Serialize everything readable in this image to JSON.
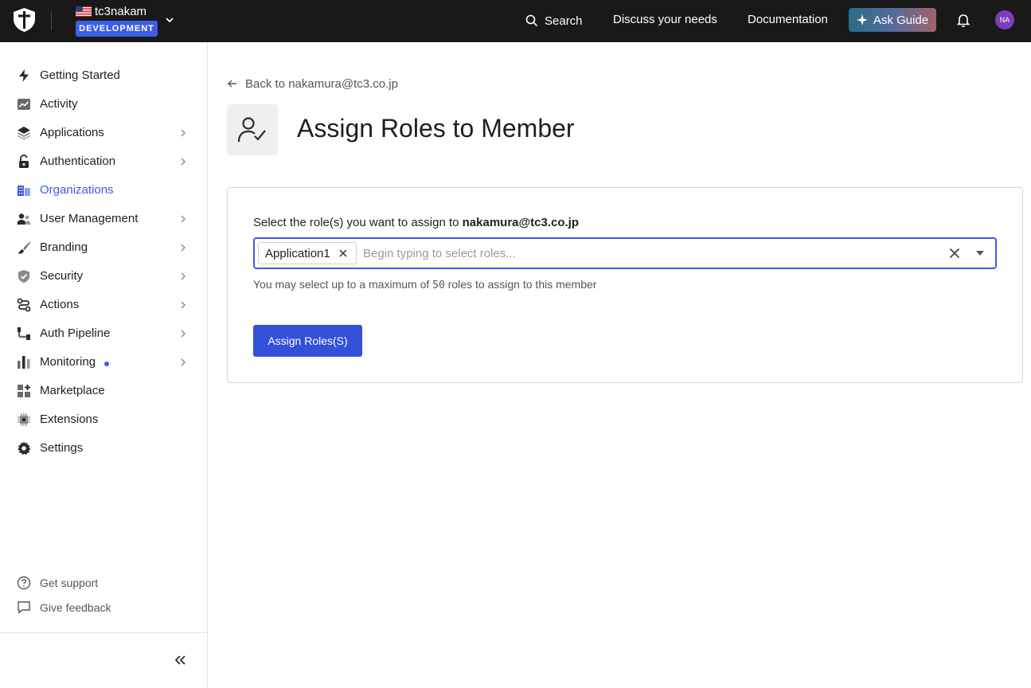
{
  "topbar": {
    "tenant_name": "tc3nakam",
    "environment": "DEVELOPMENT",
    "search_label": "Search",
    "discuss_label": "Discuss your needs",
    "docs_label": "Documentation",
    "ask_guide_label": "Ask Guide",
    "avatar_initials": "NA"
  },
  "sidebar": {
    "items": [
      {
        "label": "Getting Started",
        "icon": "bolt-icon"
      },
      {
        "label": "Activity",
        "icon": "activity-icon"
      },
      {
        "label": "Applications",
        "icon": "layers-icon"
      },
      {
        "label": "Authentication",
        "icon": "lock-icon"
      },
      {
        "label": "Organizations",
        "icon": "organizations-icon"
      },
      {
        "label": "User Management",
        "icon": "users-icon"
      },
      {
        "label": "Branding",
        "icon": "brush-icon"
      },
      {
        "label": "Security",
        "icon": "shield-icon"
      },
      {
        "label": "Actions",
        "icon": "actions-icon"
      },
      {
        "label": "Auth Pipeline",
        "icon": "pipeline-icon"
      },
      {
        "label": "Monitoring",
        "icon": "bar-chart-icon"
      },
      {
        "label": "Marketplace",
        "icon": "marketplace-icon"
      },
      {
        "label": "Extensions",
        "icon": "chip-icon"
      },
      {
        "label": "Settings",
        "icon": "gear-icon"
      }
    ],
    "active": "Organizations",
    "support": {
      "label": "Get support",
      "icon": "help-circle-icon"
    },
    "feedback": {
      "label": "Give feedback",
      "icon": "feedback-icon"
    }
  },
  "main": {
    "back_link": "Back to nakamura@tc3.co.jp",
    "title": "Assign Roles to Member",
    "form": {
      "label_prefix": "Select the role(s) you want to assign to",
      "member_email": "nakamura@tc3.co.jp",
      "selected_roles": [
        "Application1"
      ],
      "input_placeholder": "Begin typing to select roles...",
      "helper_prefix": "You may select up to a maximum of",
      "helper_max": "50",
      "helper_suffix": "roles to assign to this member",
      "submit_label": "Assign Roles(S)"
    }
  },
  "colors": {
    "topbar": "#191919",
    "accent": "#3f59e4",
    "primary_button": "#3350d8"
  }
}
